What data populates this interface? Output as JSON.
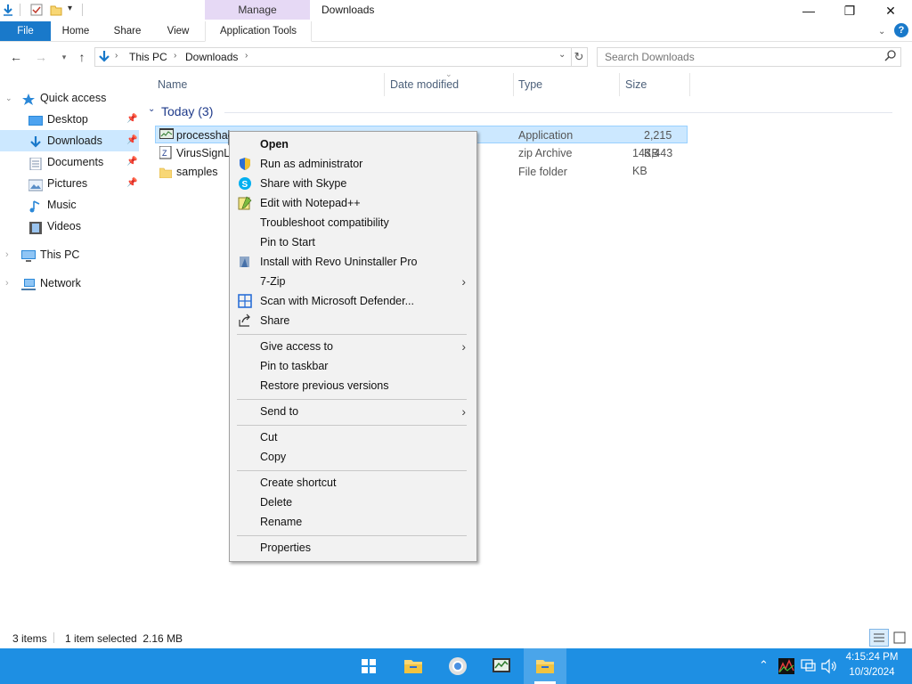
{
  "titlebar": {
    "manage_label": "Manage",
    "title": "Downloads",
    "minimize_glyph": "—",
    "maximize_glyph": "❐",
    "close_glyph": "✕"
  },
  "ribbon": {
    "tabs": [
      "File",
      "Home",
      "Share",
      "View",
      "Application Tools"
    ],
    "help_glyph": "?"
  },
  "address": {
    "segments": [
      "This PC",
      "Downloads"
    ],
    "search_placeholder": "Search Downloads"
  },
  "sidebar": {
    "items": [
      {
        "label": "Quick access",
        "icon": "star-icon"
      },
      {
        "label": "Desktop",
        "icon": "desktop-icon"
      },
      {
        "label": "Downloads",
        "icon": "download-icon"
      },
      {
        "label": "Documents",
        "icon": "documents-icon"
      },
      {
        "label": "Pictures",
        "icon": "pictures-icon"
      },
      {
        "label": "Music",
        "icon": "music-icon"
      },
      {
        "label": "Videos",
        "icon": "videos-icon"
      },
      {
        "label": "This PC",
        "icon": "computer-icon"
      },
      {
        "label": "Network",
        "icon": "network-icon"
      }
    ]
  },
  "columns": [
    "Name",
    "Date modified",
    "Type",
    "Size"
  ],
  "group": {
    "label": "Today (3)"
  },
  "files": [
    {
      "name": "processhac",
      "type": "Application",
      "size": "2,215 KB"
    },
    {
      "name": "VirusSignLi",
      "type": "zip Archive",
      "size": "143,443 KB"
    },
    {
      "name": "samples",
      "type": "File folder",
      "size": ""
    }
  ],
  "context_menu": {
    "items": [
      "Open",
      "Run as administrator",
      "Share with Skype",
      "Edit with Notepad++",
      "Troubleshoot compatibility",
      "Pin to Start",
      "Install with Revo Uninstaller Pro",
      "7-Zip",
      "Scan with Microsoft Defender...",
      "Share",
      "Give access to",
      "Pin to taskbar",
      "Restore previous versions",
      "Send to",
      "Cut",
      "Copy",
      "Create shortcut",
      "Delete",
      "Rename",
      "Properties"
    ]
  },
  "status": {
    "item_count": "3 items",
    "selection": "1 item selected  2.16 MB"
  },
  "taskbar": {
    "time": "4:15:24 PM",
    "date": "10/3/2024"
  },
  "colors": {
    "accent": "#1979ca",
    "selection": "#cce8ff",
    "manage_tab": "#e6d9f5",
    "taskbar": "#1e8fe3"
  }
}
